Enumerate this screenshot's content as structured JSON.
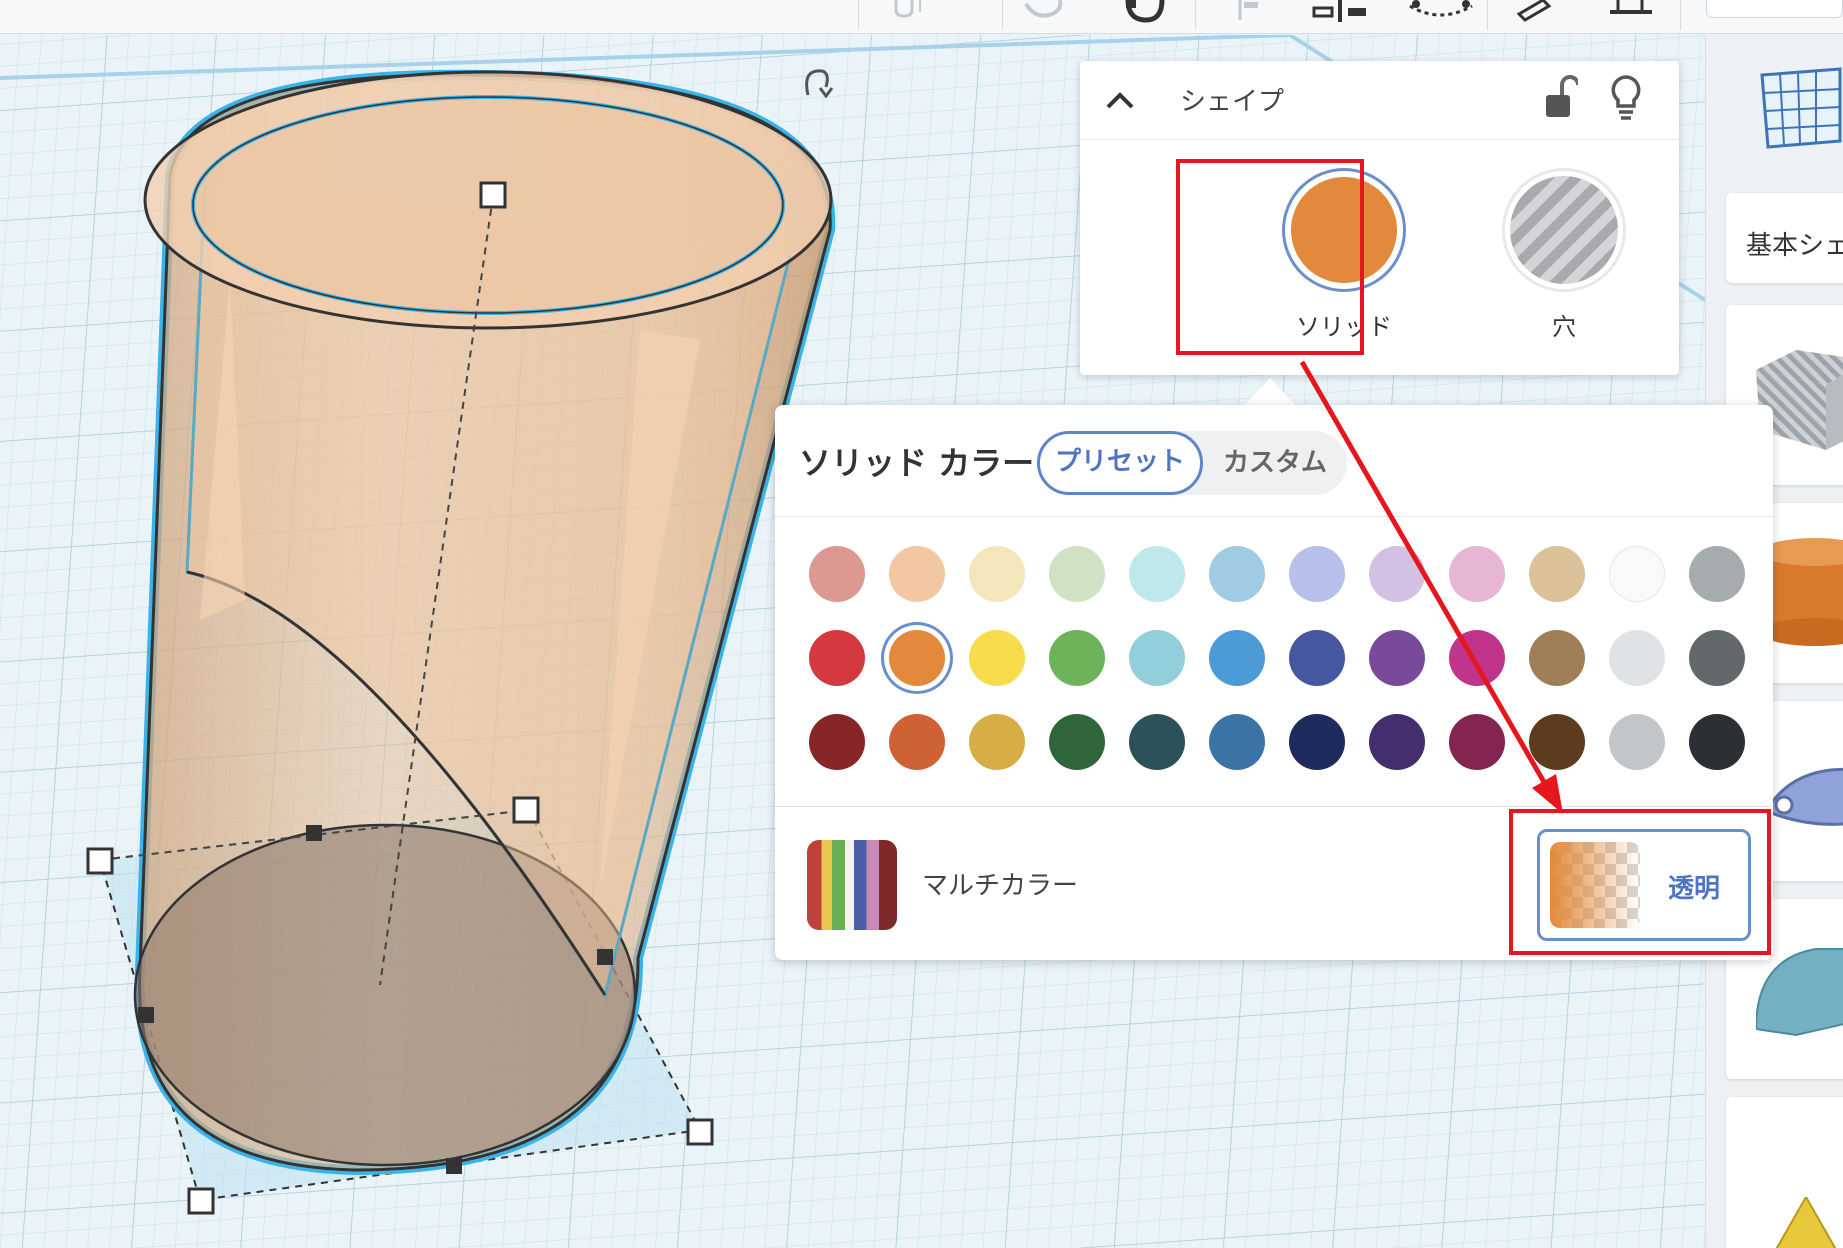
{
  "shape_panel": {
    "title": "シェイプ",
    "collapse_icon": "chevron-up-icon",
    "lock_icon": "unlock-icon",
    "bulb_icon": "lightbulb-icon",
    "options": [
      {
        "label": "ソリッド",
        "selected": true,
        "color": "#e2893b"
      },
      {
        "label": "穴",
        "selected": false,
        "pattern": "striped-gray"
      }
    ]
  },
  "color_panel": {
    "title": "ソリッド カラー",
    "tabs": [
      {
        "label": "プリセット",
        "active": true
      },
      {
        "label": "カスタム",
        "active": false
      }
    ],
    "swatch_rows": [
      [
        "#dc9891",
        "#f3c7a1",
        "#f3e6bb",
        "#d0e2c3",
        "#bee8ec",
        "#9fcbe3",
        "#b7bfeb",
        "#d2c1e3",
        "#e6b6d4",
        "#dbc197",
        "#f8f9f9",
        "#a6abae"
      ],
      [
        "#d33a3f",
        "#e2893b",
        "#f7dc4b",
        "#6db35a",
        "#93cfdb",
        "#4c9bd6",
        "#4557a0",
        "#784a99",
        "#c1348c",
        "#a07e58",
        "#dfe3e5",
        "#63696b"
      ],
      [
        "#862628",
        "#cf6234",
        "#d7ae46",
        "#2f6639",
        "#2d5158",
        "#3c73a7",
        "#1f2b5d",
        "#452e6d",
        "#832550",
        "#5c3b1e",
        "#c2c6c9",
        "#2c2f33"
      ]
    ],
    "selected_swatch": "#e2893b",
    "multicolor_label": "マルチカラー",
    "transparent_label": "透明"
  },
  "sidebar": {
    "dropdown_label": "基本シェイプ"
  },
  "colors": {
    "accent_blue": "#5e85cc",
    "highlight_red": "#e5161d",
    "selection_outline": "#3ab4e8"
  }
}
